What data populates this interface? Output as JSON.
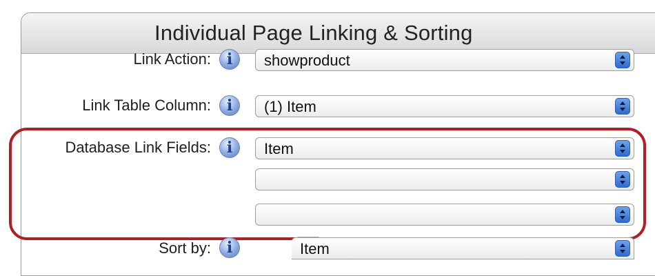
{
  "panel": {
    "title": "Individual Page Linking & Sorting"
  },
  "rows": {
    "link_action": {
      "label": "Link Action:",
      "value": "showproduct"
    },
    "link_table_column": {
      "label": "Link Table Column:",
      "value": "(1) Item"
    },
    "database_link_fields": {
      "label": "Database Link Fields:",
      "values": [
        "Item",
        "",
        ""
      ]
    },
    "sort_by": {
      "label": "Sort by:",
      "value": "Item"
    }
  },
  "icons": {
    "info": "info-icon",
    "info_glyph": "i",
    "sort": "sort-direction-icon",
    "dropdown": "dropdown-arrows-icon"
  },
  "colors": {
    "highlight": "#b01e28",
    "popup_arrow": "#2e6bd1"
  }
}
